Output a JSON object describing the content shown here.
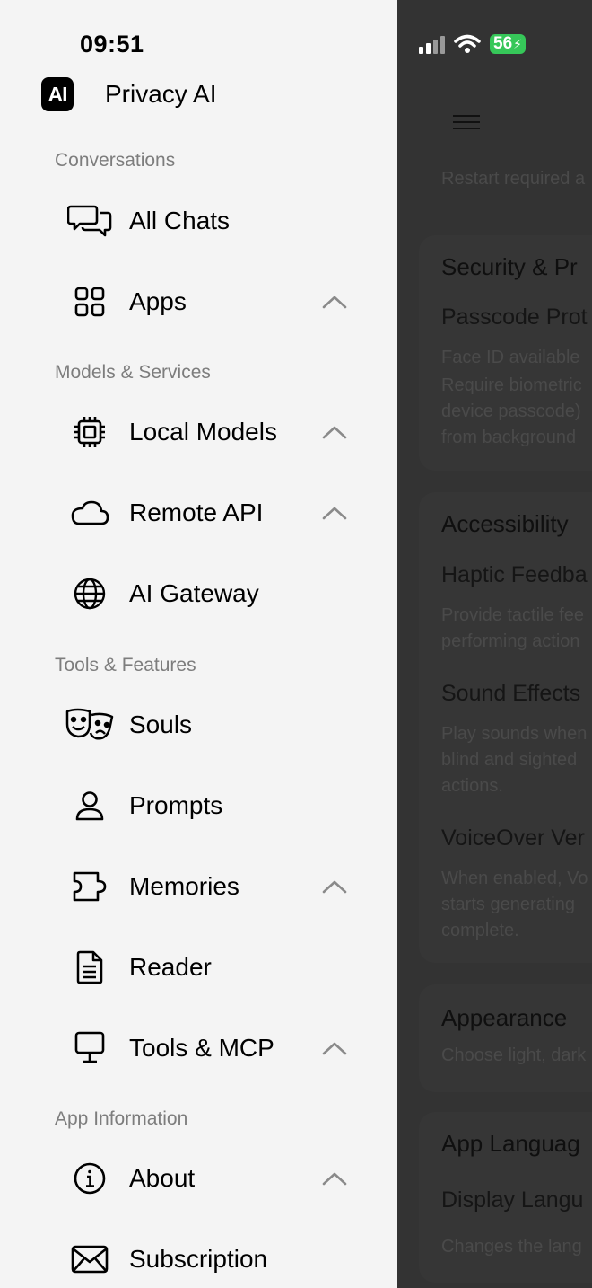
{
  "status_bar": {
    "time": "09:51",
    "battery": "56"
  },
  "app": {
    "name": "Privacy AI",
    "logo": "AI"
  },
  "sections": {
    "conversations": "Conversations",
    "models": "Models & Services",
    "tools": "Tools & Features",
    "info": "App Information"
  },
  "nav": {
    "all_chats": "All Chats",
    "apps": "Apps",
    "local_models": "Local Models",
    "remote_api": "Remote API",
    "ai_gateway": "AI Gateway",
    "souls": "Souls",
    "prompts": "Prompts",
    "memories": "Memories",
    "reader": "Reader",
    "tools_mcp": "Tools & MCP",
    "about": "About",
    "subscription": "Subscription"
  },
  "background": {
    "restart": "Restart required a",
    "security_title": "Security & Pr",
    "passcode": "Passcode Prot",
    "faceid": "Face ID available",
    "require1": "Require biometric",
    "require2": "device passcode)",
    "require3": "from background",
    "accessibility_title": "Accessibility",
    "haptic": "Haptic Feedba",
    "haptic_d1": "Provide tactile fee",
    "haptic_d2": "performing action",
    "sound": "Sound Effects",
    "sound_d1": "Play sounds when",
    "sound_d2": "blind and sighted",
    "sound_d3": "actions.",
    "voiceover": "VoiceOver Ver",
    "vo_d1": "When enabled, Vo",
    "vo_d2": "starts generating",
    "vo_d3": "complete.",
    "appearance_title": "Appearance",
    "appearance_d": "Choose light, dark",
    "language_title": "App Languag",
    "display_lang": "Display Langu",
    "display_lang_d": "Changes the lang"
  },
  "colors": {
    "drawer_bg": "#f4f4f4",
    "overlay_bg": "#333333",
    "battery": "#36c759"
  }
}
